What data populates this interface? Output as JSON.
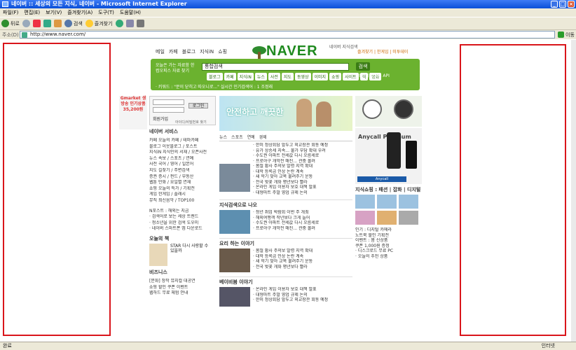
{
  "window": {
    "title": "네이버 :: 세상의 모든 지식, 네이버 - Microsoft Internet Explorer",
    "minimize": "_",
    "maximize": "□",
    "close": "×"
  },
  "menu": [
    "파일(F)",
    "편집(E)",
    "보기(V)",
    "즐겨찾기(A)",
    "도구(T)",
    "도움말(H)"
  ],
  "toolbar": {
    "back": "뒤로",
    "search": "검색",
    "favorites": "즐겨찾기"
  },
  "address": {
    "label": "주소(D)",
    "url": "http://www.naver.com/",
    "go": "이동"
  },
  "status": {
    "left": "완료",
    "right": "인터넷"
  },
  "site": {
    "topnav": [
      "메일",
      "카페",
      "블로그",
      "지식iN",
      "쇼핑"
    ],
    "logo": "NAVER",
    "logo_sub": "네이버 지식검색",
    "toplinks": "즐겨찾기 | 한게임 | 미투데이",
    "greenbar_left": "오늘은 가는 자료함 한컴오피스 자료 찾기",
    "search_value": "통합검색",
    "search_button": "검색",
    "search_tabs": [
      "블로그",
      "카페",
      "지식iN",
      "뉴스",
      "사전",
      "지도",
      "동영상",
      "이미지",
      "쇼핑",
      "사이트",
      "책",
      "영화"
    ],
    "greenbar_right": "네이버 Open API",
    "ticker": "· 키워드 : \"문이 닫히고 따오니로...\"   실시간 인기검색어 : 1 조정래",
    "left_banner": "Gmarket 생방송 인기상품 35,200원",
    "login": {
      "id_label": "아이디",
      "pw_label": "비밀번호",
      "login_button": "로그인",
      "join": "회원가입",
      "find": "아이디/비밀번호 찾기"
    },
    "services_title": "네이버 서비스",
    "services": [
      "카페  오늘의 카페 / 테마카페",
      "블로그  이웃블로그 / 포스트",
      "지식iN  지식인의 서재 / 오픈사전",
      "뉴스  속보 / 스포츠 / 연예",
      "사전  국어 / 영어 / 일본어",
      "지도  길찾기 / 주변검색",
      "증권  증시 / 펀드 / 부동산",
      "웹툰  만화 / 요일별 연재",
      "쇼핑  오늘의 특가 / 기획전",
      "게임  한게임 / 플래시",
      "뮤직  최신음악 / TOP100"
    ],
    "left_extra": [
      "N포스트 : 해외는 지금",
      "· 검색어로 보는 세상 트렌드",
      "· 청소년을 위한 검색 도우미",
      "· 네이버 스마트폰 앱 다운로드"
    ],
    "today_book": "오늘의 책",
    "book_title": "STAR 다시 사랑할 수 있을까",
    "biz_title": "비즈니스",
    "biz_items": [
      "[문화] 창작 뮤지컬 대공연",
      "쇼핑 할인 쿠폰 이벤트",
      "웹하드 무료 체험 안내"
    ],
    "banner_text": "안전하고 깨끗한",
    "news_head": [
      "뉴스",
      "스포츠",
      "연예",
      "경제"
    ],
    "news_items": [
      "· 한미 정상회담 앞두고 외교장관 회동 예정",
      "· 유가 상승세 지속... 물가 부담 확대 우려",
      "· 수도권 아파트 전세값 다시 오름세로",
      "· 프로야구 개막전 매진... 관중 몰려",
      "· 봄철 황사 주의보 발령 지역 확대",
      "· 대학 등록금 인상 논란 계속",
      "· 새 학기 맞아 교복 물려주기 운동",
      "· 전국 벚꽃 개화 평년보다 빨라",
      "· 온라인 게임 이용자 보호 대책 발표",
      "· 대형마트 주말 영업 규제 논의",
      "· 청년 취업 박람회 이번 주 개최",
      "· 해외여행객 작년보다 크게 늘어"
    ],
    "section2": "지식검색으로 나오",
    "section3": "요리 하는 이야기",
    "section4": "베이비붐 이야기",
    "right_ad": "Anycall Platinum",
    "shop_title": "지식쇼핑 : 패션 | 잡화 | 디지털",
    "right_list": [
      "인기 : 디지털 카메라",
      "노트북 할인 기획전",
      "이벤트 : 봄 신상품",
      "쿠폰 1,000원 증정",
      "· 디스크로드 무료 PC",
      "· 오늘의 추천 상품"
    ]
  }
}
